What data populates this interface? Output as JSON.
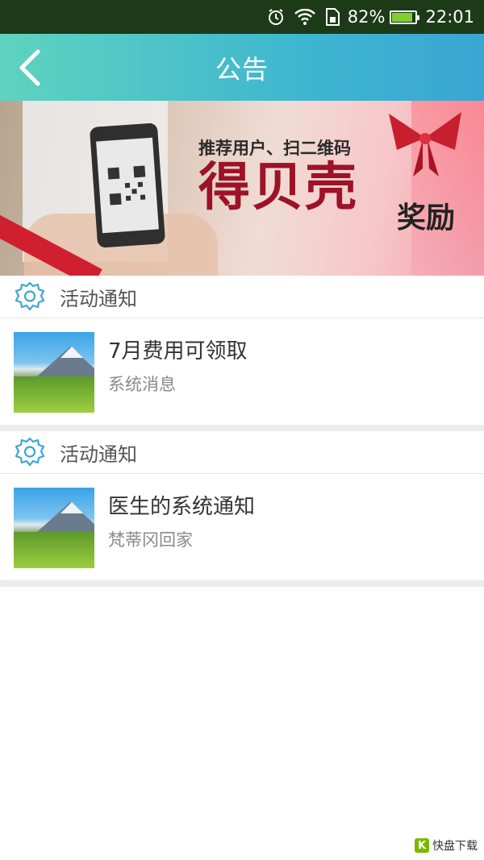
{
  "status_bar": {
    "icons": [
      "alarm-icon",
      "wifi-icon",
      "sim-icon"
    ],
    "battery_percent": "82%",
    "battery_level": 0.82,
    "time": "22:01",
    "background": "#1d3a18"
  },
  "header": {
    "title": "公告",
    "back_icon": "chevron-left-icon",
    "gradient": [
      "#5fd3bf",
      "#3aa6d3"
    ]
  },
  "banner": {
    "line1": "推荐用户、扫二维码",
    "line2": "得贝壳",
    "line3": "奖励"
  },
  "sections": [
    {
      "header_label": "活动通知",
      "header_icon": "gear-icon",
      "item": {
        "title": "7月费用可领取",
        "subtitle": "系统消息",
        "thumb_icon": "mountain-landscape-image"
      }
    },
    {
      "header_label": "活动通知",
      "header_icon": "gear-icon",
      "item": {
        "title": "医生的系统通知",
        "subtitle": "梵蒂冈回家",
        "thumb_icon": "mountain-landscape-image"
      }
    }
  ],
  "watermark": {
    "badge": "K",
    "text": "快盘下载"
  }
}
